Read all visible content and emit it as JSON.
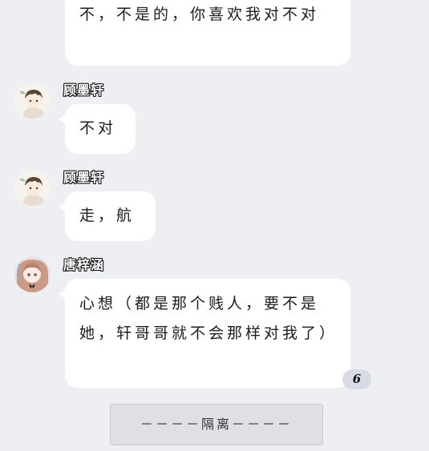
{
  "messages": [
    {
      "id": "m1",
      "sender": "",
      "text": "不，不是的，你喜欢我对不对"
    },
    {
      "id": "m2",
      "sender": "顾墨轩",
      "text": "不对"
    },
    {
      "id": "m3",
      "sender": "顾墨轩",
      "text": "走，航"
    },
    {
      "id": "m4",
      "sender": "唐梓涵",
      "text": "心想（都是那个贱人，要不是她，轩哥哥就不会那样对我了）",
      "badge": "6"
    }
  ],
  "separator": "－－－－隔离－－－－",
  "colors": {
    "background": "#eeeff3",
    "bubble": "#ffffff",
    "badge": "#d8dbe5",
    "separator": "#dfe0e5"
  },
  "icons": {
    "avatar_boy": "boy-avatar-icon",
    "avatar_girl": "girl-avatar-icon"
  }
}
